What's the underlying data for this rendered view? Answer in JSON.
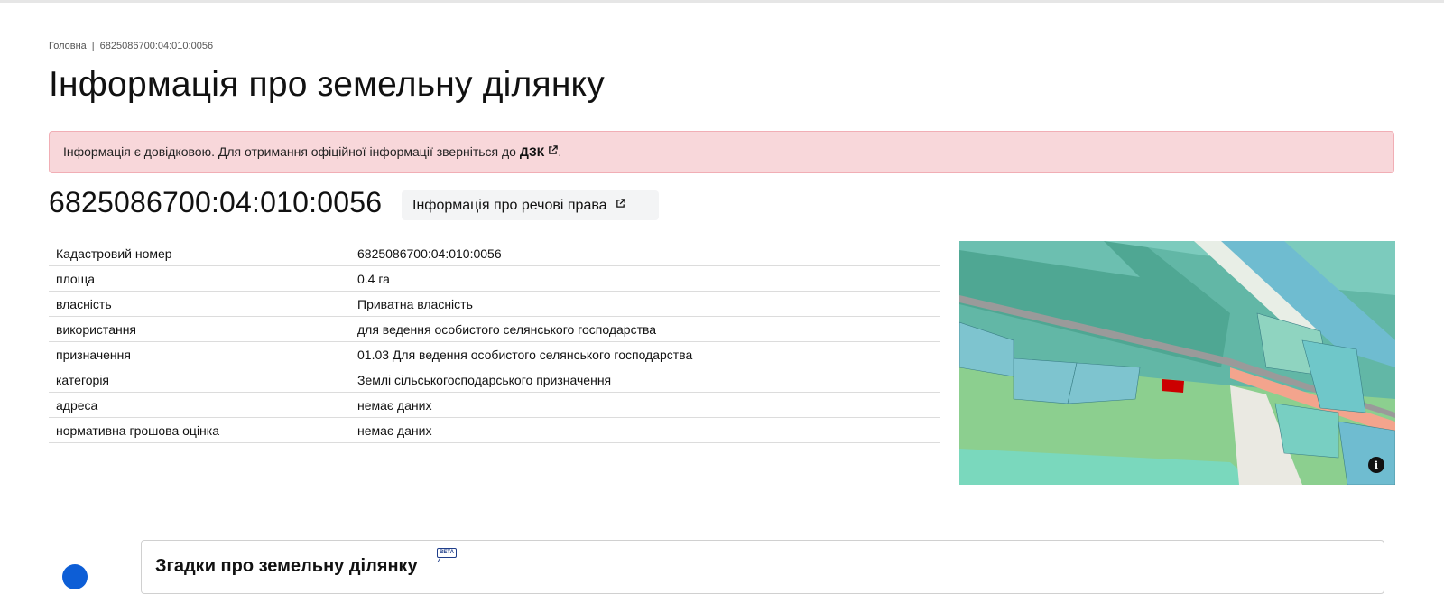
{
  "breadcrumb": {
    "home": "Головна",
    "separator": "|",
    "current": "6825086700:04:010:0056"
  },
  "page_title": "Інформація про земельну ділянку",
  "alert": {
    "text": "Інформація є довідковою. Для отримання офіційної інформації зверніться до ",
    "link_label": "ДЗК",
    "suffix": "."
  },
  "parcel": {
    "cadastral_number": "6825086700:04:010:0056",
    "rights_button_label": "Інформація про речові права"
  },
  "table": [
    {
      "key": "Кадастровий номер",
      "value": "6825086700:04:010:0056"
    },
    {
      "key": "площа",
      "value": "0.4 га"
    },
    {
      "key": "власність",
      "value": "Приватна власність"
    },
    {
      "key": "використання",
      "value": "для ведення особистого селянського господарства"
    },
    {
      "key": "призначення",
      "value": "01.03 Для ведення особистого селянського господарства"
    },
    {
      "key": "категорія",
      "value": "Землі сільськогосподарського призначення"
    },
    {
      "key": "адреса",
      "value": "немає даних"
    },
    {
      "key": "нормативна грошова оцінка",
      "value": "немає даних"
    }
  ],
  "map": {
    "info_icon": "info-icon",
    "highlight_color": "#cc0000"
  },
  "mentions": {
    "title": "Згадки про земельну ділянку",
    "badge": "BETA"
  },
  "colors": {
    "alert_bg": "#f8d7da",
    "accent": "#0d5ed6"
  }
}
